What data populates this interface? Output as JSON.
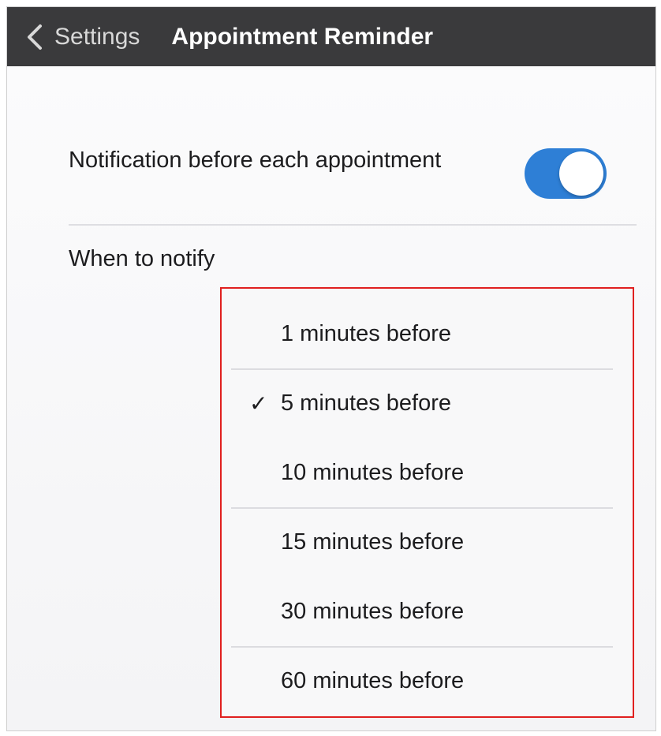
{
  "nav": {
    "back_label": "Settings",
    "title": "Appointment Reminder",
    "back_icon": "chevron-left-icon"
  },
  "notification": {
    "label": "Notification before each appointment",
    "toggle_on": true,
    "accent": "#2e7fd6"
  },
  "when": {
    "label": "When to notify"
  },
  "dropdown": {
    "selected_index": 1,
    "check_glyph": "✓",
    "options": [
      {
        "label": "1 minutes before"
      },
      {
        "label": "5 minutes before"
      },
      {
        "label": "10 minutes before"
      },
      {
        "label": "15 minutes before"
      },
      {
        "label": "30 minutes before"
      },
      {
        "label": "60 minutes before"
      }
    ],
    "highlight_color": "#e0201f"
  }
}
